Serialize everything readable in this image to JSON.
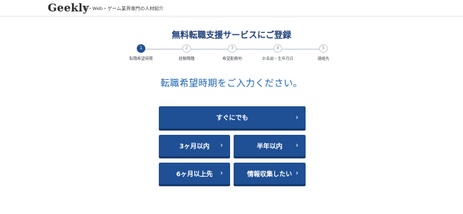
{
  "header": {
    "logo": "Geekly",
    "tagline": "IT・Web・ゲーム業界専門の人材紹介"
  },
  "title": "無料転職支援サービスにご登録",
  "steps": [
    {
      "num": "1",
      "label": "転職希望時期",
      "active": true
    },
    {
      "num": "2",
      "label": "経験職種",
      "active": false
    },
    {
      "num": "3",
      "label": "希望勤務地",
      "active": false
    },
    {
      "num": "4",
      "label": "お名前・生年月日",
      "active": false
    },
    {
      "num": "5",
      "label": "連絡先",
      "active": false
    }
  ],
  "question": "転職希望時期をご入力ください。",
  "options": {
    "asap": "すぐにでも",
    "within_3_months": "3ヶ月以内",
    "within_6_months": "半年以内",
    "after_6_months": "6ヶ月以上先",
    "gathering_info": "情報収集したい"
  },
  "colors": {
    "primary": "#1f4f94",
    "accent_text": "#1f66b6",
    "title_text": "#1e3f7a"
  },
  "icons": {
    "chevron": "chevron-right-icon"
  }
}
